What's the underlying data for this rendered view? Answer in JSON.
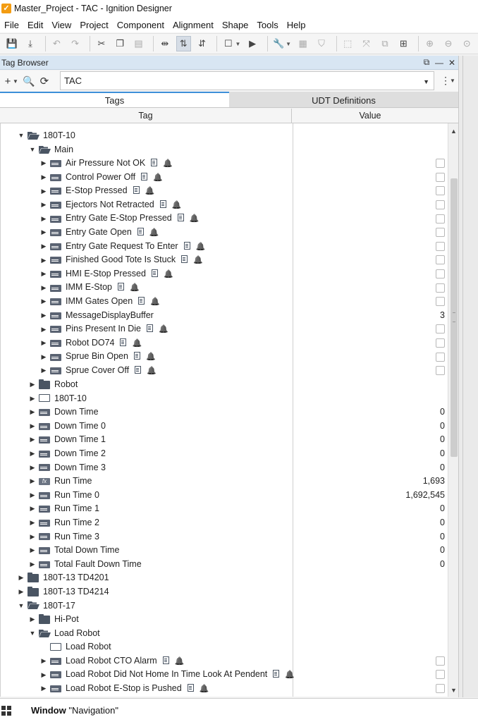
{
  "window": {
    "title": "Master_Project - TAC - Ignition Designer"
  },
  "menu": [
    "File",
    "Edit",
    "View",
    "Project",
    "Component",
    "Alignment",
    "Shape",
    "Tools",
    "Help"
  ],
  "panel": {
    "title": "Tag Browser"
  },
  "search": {
    "provider": "TAC"
  },
  "tabs": {
    "tags": "Tags",
    "udt": "UDT Definitions"
  },
  "columns": {
    "tag": "Tag",
    "value": "Value"
  },
  "tree": [
    {
      "depth": 0,
      "expanded": true,
      "icon": "folder-open",
      "name": "180T-10",
      "value": ""
    },
    {
      "depth": 1,
      "expanded": true,
      "icon": "folder-open",
      "name": "Main",
      "value": ""
    },
    {
      "depth": 2,
      "icon": "tag",
      "name": "Air Pressure Not OK",
      "doc": true,
      "alarm": true,
      "checkbox": true
    },
    {
      "depth": 2,
      "icon": "tag",
      "name": "Control Power Off",
      "doc": true,
      "alarm": true,
      "checkbox": true
    },
    {
      "depth": 2,
      "icon": "tag",
      "name": "E-Stop Pressed",
      "doc": true,
      "alarm": true,
      "checkbox": true
    },
    {
      "depth": 2,
      "icon": "tag",
      "name": "Ejectors Not Retracted",
      "doc": true,
      "alarm": true,
      "checkbox": true
    },
    {
      "depth": 2,
      "icon": "tag",
      "name": "Entry Gate E-Stop Pressed",
      "doc": true,
      "alarm": true,
      "checkbox": true
    },
    {
      "depth": 2,
      "icon": "tag",
      "name": "Entry Gate Open",
      "doc": true,
      "alarm": true,
      "checkbox": true
    },
    {
      "depth": 2,
      "icon": "tag",
      "name": "Entry Gate Request To Enter",
      "doc": true,
      "alarm": true,
      "checkbox": true
    },
    {
      "depth": 2,
      "icon": "tag",
      "name": "Finished Good Tote Is Stuck",
      "doc": true,
      "alarm": true,
      "checkbox": true
    },
    {
      "depth": 2,
      "icon": "tag",
      "name": "HMI E-Stop Pressed",
      "doc": true,
      "alarm": true,
      "checkbox": true
    },
    {
      "depth": 2,
      "icon": "tag",
      "name": "IMM E-Stop",
      "doc": true,
      "alarm": true,
      "checkbox": true
    },
    {
      "depth": 2,
      "icon": "tag",
      "name": "IMM Gates Open",
      "doc": true,
      "alarm": true,
      "checkbox": true
    },
    {
      "depth": 2,
      "icon": "tag",
      "name": "MessageDisplayBuffer",
      "value": "3"
    },
    {
      "depth": 2,
      "icon": "tag",
      "name": "Pins Present In Die",
      "doc": true,
      "alarm": true,
      "checkbox": true
    },
    {
      "depth": 2,
      "icon": "tag",
      "name": "Robot DO74",
      "doc": true,
      "alarm": true,
      "checkbox": true
    },
    {
      "depth": 2,
      "icon": "tag",
      "name": "Sprue Bin Open",
      "doc": true,
      "alarm": true,
      "checkbox": true
    },
    {
      "depth": 2,
      "icon": "tag",
      "name": "Sprue Cover Off",
      "doc": true,
      "alarm": true,
      "checkbox": true
    },
    {
      "depth": 1,
      "expanded": false,
      "icon": "folder",
      "name": "Robot",
      "value": ""
    },
    {
      "depth": 1,
      "expanded": false,
      "icon": "udt",
      "name": "180T-10",
      "value": ""
    },
    {
      "depth": 1,
      "icon": "tag",
      "name": "Down Time",
      "value": "0"
    },
    {
      "depth": 1,
      "icon": "tag",
      "name": "Down Time 0",
      "value": "0"
    },
    {
      "depth": 1,
      "icon": "tag",
      "name": "Down Time 1",
      "value": "0"
    },
    {
      "depth": 1,
      "icon": "tag",
      "name": "Down Time 2",
      "value": "0"
    },
    {
      "depth": 1,
      "icon": "tag",
      "name": "Down Time 3",
      "value": "0"
    },
    {
      "depth": 1,
      "icon": "expr",
      "name": "Run Time",
      "value": "1,693"
    },
    {
      "depth": 1,
      "icon": "tag",
      "name": "Run Time 0",
      "value": "1,692,545"
    },
    {
      "depth": 1,
      "icon": "tag",
      "name": "Run Time 1",
      "value": "0"
    },
    {
      "depth": 1,
      "icon": "tag",
      "name": "Run Time 2",
      "value": "0"
    },
    {
      "depth": 1,
      "icon": "tag",
      "name": "Run Time 3",
      "value": "0"
    },
    {
      "depth": 1,
      "icon": "tag",
      "name": "Total Down Time",
      "value": "0"
    },
    {
      "depth": 1,
      "icon": "tag",
      "name": "Total Fault Down Time",
      "value": "0"
    },
    {
      "depth": 0,
      "expanded": false,
      "icon": "folder",
      "name": "180T-13 TD4201",
      "value": ""
    },
    {
      "depth": 0,
      "expanded": false,
      "icon": "folder",
      "name": "180T-13 TD4214",
      "value": ""
    },
    {
      "depth": 0,
      "expanded": true,
      "icon": "folder-open",
      "name": "180T-17",
      "value": ""
    },
    {
      "depth": 1,
      "expanded": false,
      "icon": "folder",
      "name": "Hi-Pot",
      "value": ""
    },
    {
      "depth": 1,
      "expanded": true,
      "icon": "folder-open",
      "name": "Load Robot",
      "value": ""
    },
    {
      "depth": 2,
      "icon": "udt",
      "name": "Load Robot",
      "value": "",
      "noTwisty": true
    },
    {
      "depth": 2,
      "icon": "tag",
      "name": "Load Robot CTO Alarm",
      "doc": true,
      "alarm": true,
      "checkbox": true
    },
    {
      "depth": 2,
      "icon": "tag",
      "name": "Load Robot Did Not Home In Time Look At Pendent",
      "doc": true,
      "alarm": true,
      "checkbox": true
    },
    {
      "depth": 2,
      "icon": "tag",
      "name": "Load Robot E-Stop is Pushed",
      "doc": true,
      "alarm": true,
      "checkbox": true
    }
  ],
  "status": {
    "prefix": "Window",
    "value": "\"Navigation\""
  }
}
